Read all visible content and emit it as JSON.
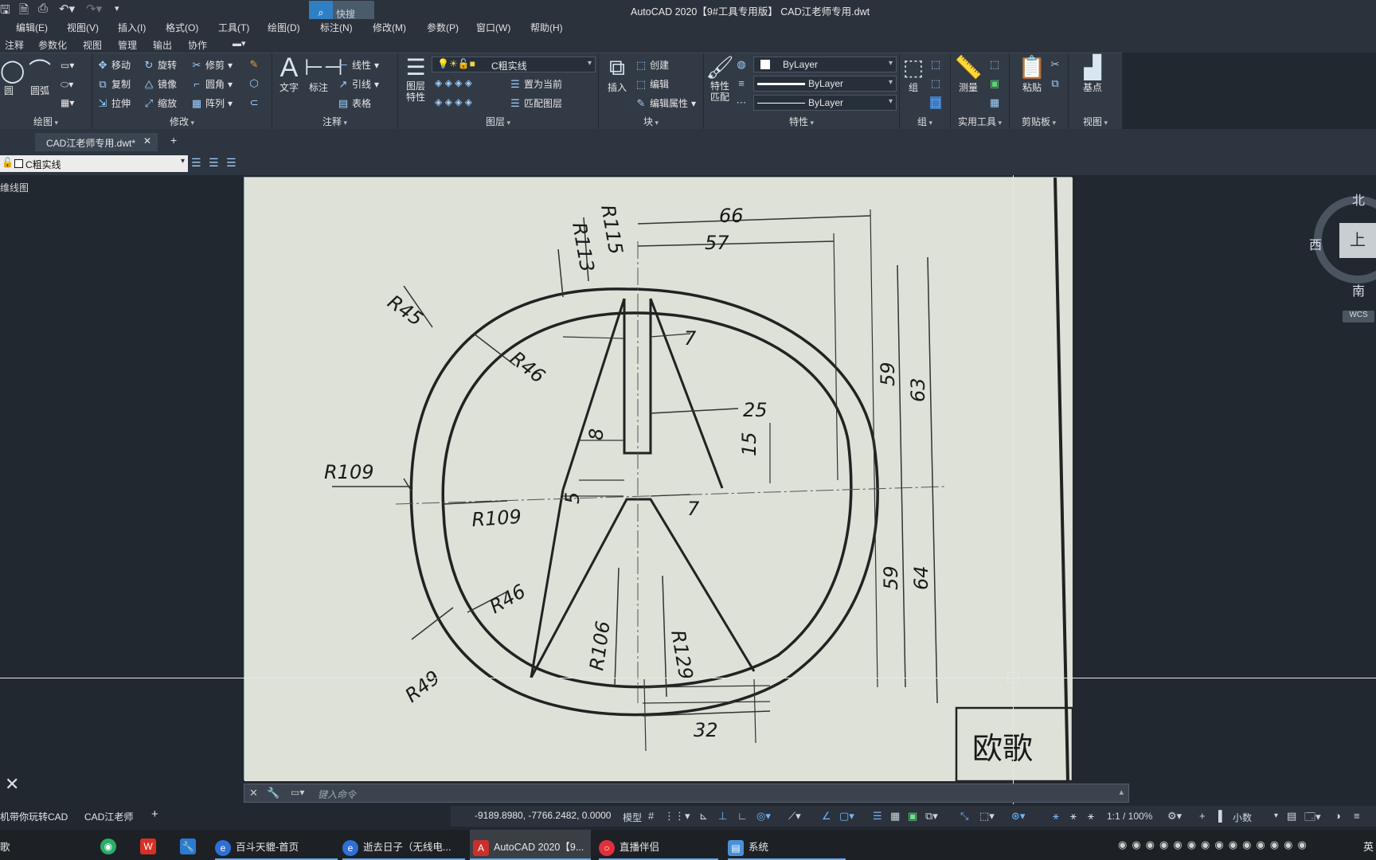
{
  "window": {
    "title": "AutoCAD 2020【9#工具专用版】   CAD江老师专用.dwt"
  },
  "quick_search": {
    "label": "快搜"
  },
  "menu": [
    "编辑(E)",
    "视图(V)",
    "插入(I)",
    "格式(O)",
    "工具(T)",
    "绘图(D)",
    "标注(N)",
    "修改(M)",
    "参数(P)",
    "窗口(W)",
    "帮助(H)"
  ],
  "ribbon_tabs": [
    "注释",
    "参数化",
    "视图",
    "管理",
    "输出",
    "协作"
  ],
  "ribbon": {
    "draw": {
      "label": "绘图",
      "circle": "圆",
      "arc": "圆弧"
    },
    "modify": {
      "label": "修改",
      "move": "移动",
      "rotate": "旋转",
      "trim": "修剪",
      "copy": "复制",
      "mirror": "镜像",
      "fillet": "圆角",
      "stretch": "拉伸",
      "scale": "缩放",
      "array": "阵列"
    },
    "annotation": {
      "label": "注释",
      "text": "文字",
      "dimension": "标注",
      "linear": "线性",
      "leader": "引线",
      "table": "表格"
    },
    "layers": {
      "label": "图层",
      "layer_props": "图层\n特性",
      "current_layer": "C粗实线",
      "set_current": "置为当前",
      "match_layer": "匹配图层"
    },
    "block": {
      "label": "块",
      "insert": "插入",
      "create": "创建",
      "edit": "编辑",
      "edit_attr": "编辑属性"
    },
    "properties": {
      "label": "特性",
      "match": "特性\n匹配",
      "color": "ByLayer",
      "linetype": "ByLayer",
      "lineweight": "ByLayer"
    },
    "groups": {
      "label": "组",
      "group": "组"
    },
    "utilities": {
      "label": "实用工具",
      "measure": "测量"
    },
    "clipboard": {
      "label": "剪贴板",
      "paste": "粘贴"
    },
    "view": {
      "label": "视图",
      "base": "基点"
    }
  },
  "doc_tab": {
    "label": "CAD江老师专用.dwt*"
  },
  "layer_dropdown": {
    "value": "C粗实线"
  },
  "viewport_label": "维线图",
  "viewcube": {
    "north": "北",
    "south": "南",
    "west": "西",
    "top": "上",
    "wcs": "WCS"
  },
  "drawing": {
    "dims": {
      "d66": "66",
      "d57": "57",
      "d7a": "7",
      "d7b": "7",
      "d25": "25",
      "d15": "15",
      "d8": "8",
      "d5": "5",
      "d59a": "59",
      "d63": "63",
      "d59b": "59",
      "d64": "64",
      "d32": "32"
    },
    "radii": {
      "r115": "R115",
      "r113": "R113",
      "r45": "R45",
      "r46a": "R46",
      "r109a": "R109",
      "r109b": "R109",
      "r46b": "R46",
      "r49": "R49",
      "r106": "R106",
      "r129": "R129"
    },
    "stamp": "欧歌"
  },
  "command_line": {
    "placeholder": "键入命令"
  },
  "layout_tabs": [
    "机带你玩转CAD",
    "CAD江老师"
  ],
  "status": {
    "coords": "-9189.8980, -7766.2482, 0.0000",
    "model": "模型",
    "scale": "1:1 / 100%",
    "units": "小数"
  },
  "taskbar": [
    {
      "label": "歌",
      "icon": "music-icon",
      "color": "#c03030"
    },
    {
      "label": "",
      "icon": "wechat-icon",
      "color": "#2aae67"
    },
    {
      "label": "",
      "icon": "wps-icon",
      "color": "#d93025"
    },
    {
      "label": "",
      "icon": "wrench-icon",
      "color": "#2b7bd3"
    },
    {
      "label": "百斗天貔-首页",
      "icon": "browser-icon",
      "color": "#2f6fd6"
    },
    {
      "label": "逝去日子（无线电...",
      "icon": "browser-icon",
      "color": "#2f6fd6"
    },
    {
      "label": "AutoCAD 2020【9...",
      "icon": "autocad-icon",
      "color": "#c9302c"
    },
    {
      "label": "直播伴侣",
      "icon": "live-icon",
      "color": "#e0303a"
    },
    {
      "label": "系统",
      "icon": "system-icon",
      "color": "#4a90d9"
    }
  ],
  "tray": {
    "lang": "英"
  }
}
